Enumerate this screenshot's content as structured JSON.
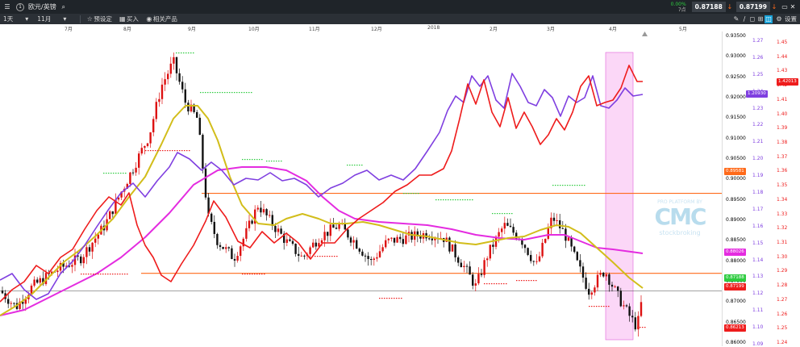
{
  "topbar": {
    "instrument": "欧元/英镑",
    "change_pct": "0.00%",
    "change_sub": "7点",
    "bid": "0.87188",
    "ask": "0.87199",
    "settings_label": "设置"
  },
  "toolbar": {
    "interval": "1天",
    "range": "11月",
    "preset": "预设定",
    "buy": "买入",
    "related": "相关产品"
  },
  "months": [
    "7月",
    "8月",
    "9月",
    "10月",
    "11月",
    "12月",
    "2018",
    "2月",
    "3月",
    "4月",
    "5月"
  ],
  "axis_main": [
    "0.93500",
    "0.93000",
    "0.92500",
    "0.92000",
    "0.91500",
    "0.91000",
    "0.90500",
    "0.90000",
    "0.89500",
    "0.89000",
    "0.88500",
    "0.88000",
    "0.87500",
    "0.87000",
    "0.86500",
    "0.86000"
  ],
  "axis_purple": [
    "1.27",
    "1.26",
    "1.25",
    "1.24",
    "1.23",
    "1.22",
    "1.21",
    "1.20",
    "1.19",
    "1.18",
    "1.17",
    "1.16",
    "1.15",
    "1.14",
    "1.13",
    "1.12",
    "1.11",
    "1.10",
    "1.09"
  ],
  "axis_red": [
    "1.45",
    "1.44",
    "1.43",
    "1.42",
    "1.41",
    "1.40",
    "1.39",
    "1.38",
    "1.37",
    "1.36",
    "1.35",
    "1.34",
    "1.33",
    "1.32",
    "1.31",
    "1.30",
    "1.29",
    "1.28",
    "1.27",
    "1.26",
    "1.25",
    "1.24"
  ],
  "tags": {
    "purple_value": "1.20930",
    "red_value": "1.42013",
    "orange_value": "0.89581",
    "magenta_value": "0.88026",
    "green_value": "0.87188",
    "red_last": "0.87199",
    "red_low": "0.86213"
  },
  "watermark": {
    "line1": "PRO PLATFORM BY",
    "logo": "CMC",
    "line2": "stockbroking"
  },
  "colors": {
    "purple": "#7f3fe0",
    "red": "#ee1c1c",
    "orange": "#ff6a1a",
    "magenta": "#e42ce0",
    "yellow": "#d2bd1a",
    "green": "#2ecc40",
    "highlight": "#f7b6f0"
  },
  "chart_data": [
    {
      "type": "candlestick",
      "series": [
        {
          "name": "",
          "x_range": [
            "2017-07",
            "2018-05"
          ],
          "y_range": [
            0.86,
            0.935
          ]
        }
      ],
      "reference_lines": [
        0.89581,
        0.87625,
        0.87199
      ],
      "last_price": 0.87199
    }
  ]
}
